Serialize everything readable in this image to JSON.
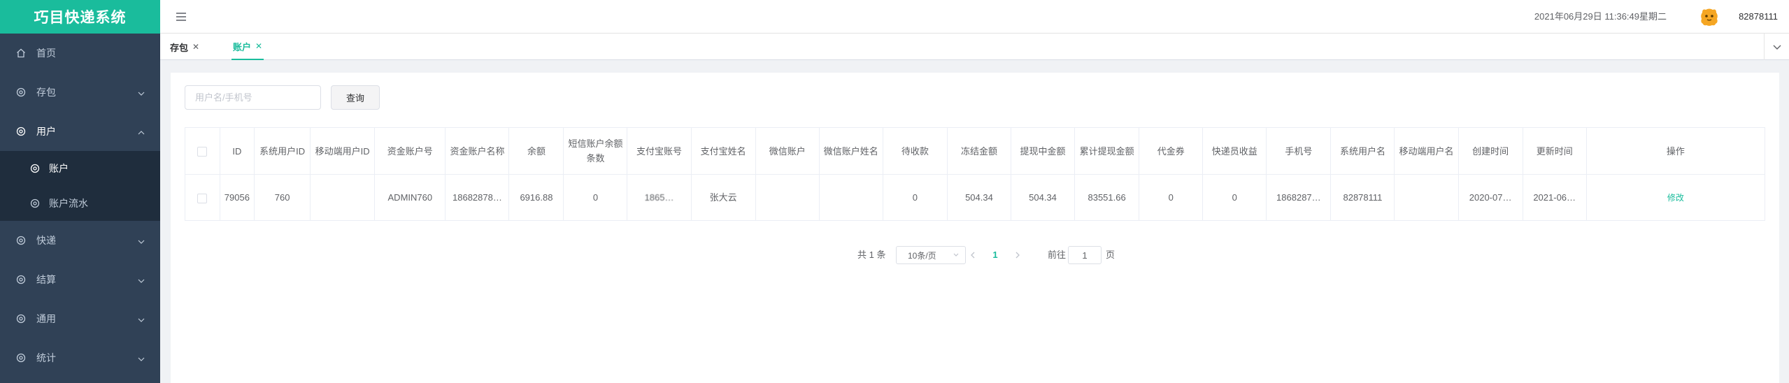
{
  "app": {
    "title": "巧目快递系统"
  },
  "sidebar": {
    "items": [
      {
        "label": "首页",
        "icon": "home-icon"
      },
      {
        "label": "存包",
        "icon": "settings-icon"
      },
      {
        "label": "用户",
        "icon": "settings-icon",
        "expanded": true,
        "children": [
          {
            "label": "账户",
            "active": true
          },
          {
            "label": "账户流水"
          }
        ]
      },
      {
        "label": "快递",
        "icon": "settings-icon"
      },
      {
        "label": "结算",
        "icon": "settings-icon"
      },
      {
        "label": "通用",
        "icon": "settings-icon"
      },
      {
        "label": "统计",
        "icon": "settings-icon"
      }
    ]
  },
  "header": {
    "datetime": "2021年06月29日 11:36:49星期二",
    "username": "82878111"
  },
  "tags": [
    {
      "label": "存包",
      "active": false
    },
    {
      "label": "账户",
      "active": true
    }
  ],
  "search": {
    "placeholder": "用户名/手机号",
    "button_label": "查询"
  },
  "table": {
    "columns": [
      "ID",
      "系统用户ID",
      "移动端用户ID",
      "资金账户号",
      "资金账户名称",
      "余额",
      "短信账户余额条数",
      "支付宝账号",
      "支付宝姓名",
      "微信账户",
      "微信账户姓名",
      "待收款",
      "冻结金额",
      "提现中金额",
      "累计提现金额",
      "代金券",
      "快递员收益",
      "手机号",
      "系统用户名",
      "移动端用户名",
      "创建时间",
      "更新时间",
      "操作"
    ],
    "rows": [
      {
        "id": "79056",
        "sys_user_id": "760",
        "mobile_user_id": "",
        "fund_account_no": "ADMIN760",
        "fund_account_name": "18682878…",
        "balance": "6916.88",
        "sms_balance": "0",
        "alipay_account": "1865…",
        "alipay_name": "张大云",
        "wechat_account": "",
        "wechat_name": "",
        "pending": "0",
        "frozen": "504.34",
        "withdrawing": "504.34",
        "total_withdrawn": "83551.66",
        "voucher": "0",
        "courier_income": "0",
        "phone": "1868287…",
        "sys_username": "82878111",
        "mobile_username": "",
        "created": "2020-07…",
        "updated": "2021-06…",
        "action": "修改"
      }
    ]
  },
  "pagination": {
    "total": "共 1 条",
    "page_size": "10条/页",
    "current": "1",
    "goto_label": "前往",
    "goto_value": "1",
    "page_suffix": "页"
  },
  "colors": {
    "primary": "#1abc9c",
    "sidebar": "#304156",
    "sidebar_sub": "#1f2d3d"
  }
}
